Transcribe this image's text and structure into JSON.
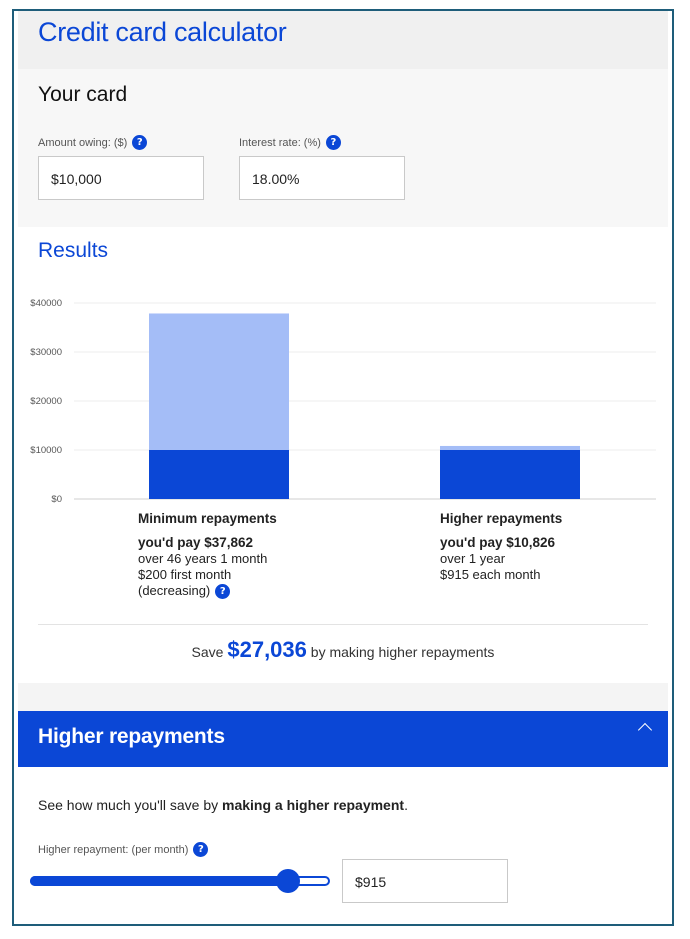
{
  "header": {
    "title": "Credit card calculator"
  },
  "card": {
    "heading": "Your card",
    "amount": {
      "label": "Amount owing: ($)",
      "value": "$10,000"
    },
    "rate": {
      "label": "Interest rate: (%)",
      "value": "18.00%"
    },
    "help_glyph": "?"
  },
  "results": {
    "heading": "Results",
    "minimum": {
      "title": "Minimum repayments",
      "pay": "you'd pay $37,862",
      "duration": "over 46 years 1 month",
      "monthly": "$200 first month",
      "note": "(decreasing)"
    },
    "higher": {
      "title": "Higher repayments",
      "pay": "you'd pay $10,826",
      "duration": "over 1 year",
      "monthly": "$915 each month"
    },
    "save": {
      "prefix": "Save",
      "amount": "$27,036",
      "suffix": "by making higher repayments"
    }
  },
  "chart_data": {
    "type": "bar",
    "stacked": true,
    "categories": [
      "Minimum repayments",
      "Higher repayments"
    ],
    "series": [
      {
        "values": [
          10000,
          10000
        ],
        "color": "#0b47d6"
      },
      {
        "values": [
          27862,
          826
        ],
        "color": "#a4bdf7"
      }
    ],
    "ylim": [
      0,
      40000
    ],
    "yticks": [
      0,
      10000,
      20000,
      30000,
      40000
    ],
    "ytick_labels": [
      "$0",
      "$10000",
      "$20000",
      "$30000",
      "$40000"
    ],
    "grid": true
  },
  "accordion": {
    "title": "Higher repayments",
    "icon": "chevron-up-icon",
    "description_prefix": "See how much you'll save by ",
    "description_bold": "making a higher repayment",
    "description_suffix": ".",
    "repayment_label": "Higher repayment: (per month)",
    "repayment_value": "$915",
    "slider_fraction": 0.86
  },
  "colors": {
    "accent": "#0b47d6",
    "accent_light": "#a4bdf7",
    "border": "#1e5d7a"
  }
}
